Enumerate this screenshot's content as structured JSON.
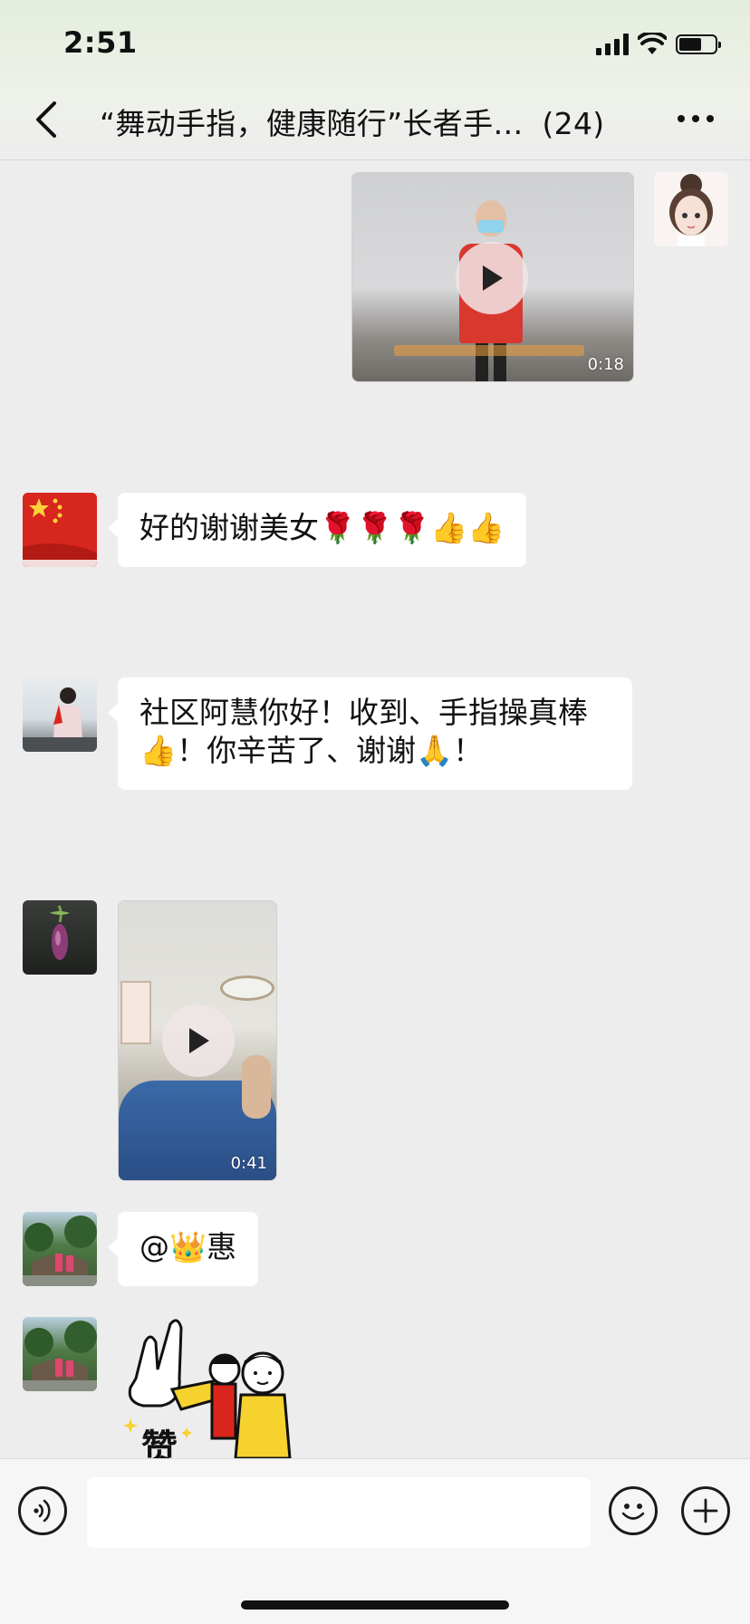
{
  "status_bar": {
    "time": "2:51"
  },
  "nav": {
    "title": "“舞动手指，健康随行”长者手…",
    "member_count": "(24)"
  },
  "messages": [
    {
      "type": "video",
      "side": "right",
      "duration": "0:18"
    },
    {
      "type": "text",
      "side": "left",
      "text": "好的谢谢美女🌹🌹🌹👍👍"
    },
    {
      "type": "text",
      "side": "left",
      "line1": "社区阿慧你好！收到、手指操真棒",
      "line2": "👍！你辛苦了、谢谢🙏！"
    },
    {
      "type": "video",
      "side": "left",
      "duration": "0:41"
    },
    {
      "type": "text",
      "side": "left",
      "text": "@👑惠"
    },
    {
      "type": "sticker",
      "side": "left",
      "caption": "赞"
    }
  ],
  "input": {
    "value": "",
    "placeholder": ""
  },
  "icons": {
    "back": "chevron-left-icon",
    "more": "ellipsis-icon",
    "voice": "voice-icon",
    "emoji": "smiley-icon",
    "plus": "plus-icon"
  }
}
